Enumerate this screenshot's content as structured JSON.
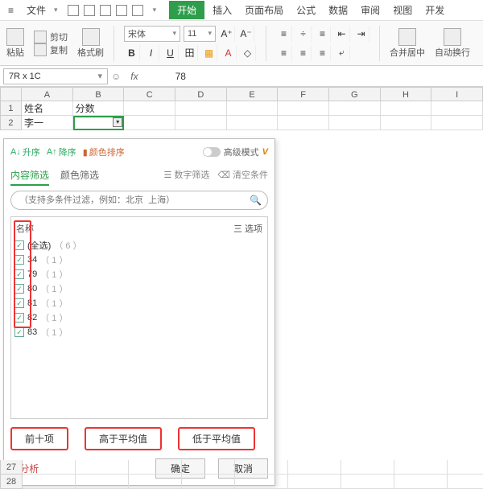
{
  "menubar": {
    "file": "文件",
    "tabs": [
      "开始",
      "插入",
      "页面布局",
      "公式",
      "数据",
      "审阅",
      "视图",
      "开发"
    ]
  },
  "ribbon": {
    "paste": "粘贴",
    "cut": "剪切",
    "copy": "复制",
    "format_painter": "格式刷",
    "font_name": "宋体",
    "font_size": "11",
    "merge_center": "合并居中",
    "auto_wrap": "自动换行"
  },
  "formula_bar": {
    "name_box": "7R x 1C",
    "fx": "fx",
    "value": "78"
  },
  "columns": [
    "A",
    "B",
    "C",
    "D",
    "E",
    "F",
    "G",
    "H",
    "I"
  ],
  "data_rows": [
    {
      "n": "1",
      "A": "姓名",
      "B": "分数"
    },
    {
      "n": "2",
      "A": "李一",
      "B": ""
    }
  ],
  "tail_rows": [
    "27",
    "28"
  ],
  "filter": {
    "sort_asc": "升序",
    "sort_desc": "降序",
    "sort_color": "颜色排序",
    "advanced": "高级模式",
    "tab_content": "内容筛选",
    "tab_color": "颜色筛选",
    "tab_number": "数字筛选",
    "clear": "清空条件",
    "search_placeholder": "（支持多条件过滤，例如：北京  上海）",
    "col_name": "名称",
    "options": "选项",
    "opt_icon": "三",
    "items": [
      {
        "label": "(全选)",
        "count": "（ 6 ）"
      },
      {
        "label": "34",
        "count": "（ 1 ）"
      },
      {
        "label": "79",
        "count": "（ 1 ）"
      },
      {
        "label": "80",
        "count": "（ 1 ）"
      },
      {
        "label": "81",
        "count": "（ 1 ）"
      },
      {
        "label": "82",
        "count": "（ 1 ）"
      },
      {
        "label": "83",
        "count": "（ 1 ）"
      }
    ],
    "top10": "前十项",
    "above_avg": "高于平均值",
    "below_avg": "低于平均值",
    "analysis": "分析",
    "ok": "确定",
    "cancel": "取消"
  }
}
